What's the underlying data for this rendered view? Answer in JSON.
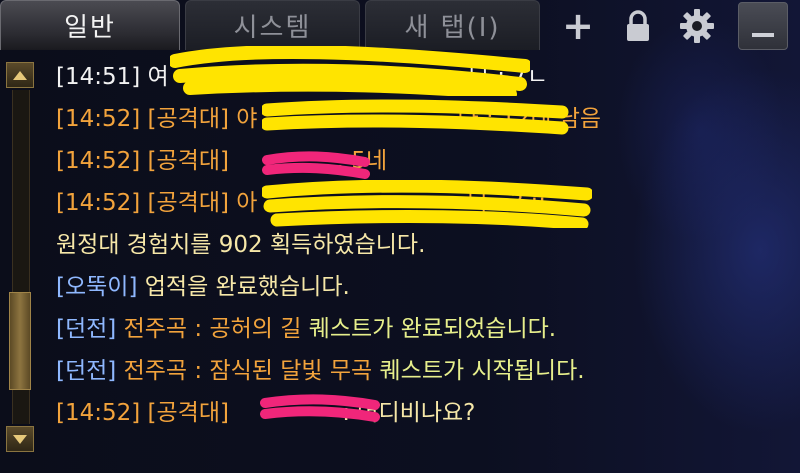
{
  "tabs": {
    "general": "일반",
    "system": "시스템",
    "new_tab": "새 탭(I)"
  },
  "buttons": {
    "add": "+",
    "lock_icon": "lock-icon",
    "settings_icon": "gear-icon",
    "minimize_icon": "minimize-icon"
  },
  "chat": {
    "lines": [
      {
        "time": "[14:51]",
        "channel": "",
        "name": "여",
        "message": "나 : 7ㄴ",
        "color": "#f2f2f2"
      },
      {
        "time": "[14:52]",
        "channel": "[공격대]",
        "name": "야",
        "message": "나 : 12네 남음",
        "color": "#f2a33c"
      },
      {
        "time": "[14:52]",
        "channel": "[공격대]",
        "name": "",
        "message": ": 5네",
        "color": "#f2a33c"
      },
      {
        "time": "[14:52]",
        "channel": "[공격대]",
        "name": "아",
        "message": "나 : ? ;;",
        "color": "#f2a33c"
      }
    ],
    "exp_message": "원정대 경험치를 902 획득하였습니다.",
    "achievement": {
      "tag": "[오뚝이]",
      "message": "업적을 완료했습니다."
    },
    "quest_complete": {
      "tag": "[던전]",
      "quest": "전주곡 : 공허의 길",
      "message": "퀘스트가 완료되었습니다."
    },
    "quest_start": {
      "tag": "[던전]",
      "quest": "전주곡 : 잠식된 달빛 무곡",
      "message": "퀘스트가 시작됩니다."
    },
    "last_line": {
      "time": "[14:52]",
      "channel": "[공격대]",
      "message": ": 어디비나요?"
    }
  },
  "colors": {
    "raid_orange": "#f2a33c",
    "system_yellow": "#f6e7a8",
    "tag_blue": "#8fb8ff",
    "quest_orange": "#f2a33c",
    "quest_lime": "#e7ef8c",
    "redact_yellow": "#ffe400",
    "redact_pink": "#f0267a"
  },
  "scrollbar": {
    "position_fraction": 0.78
  }
}
